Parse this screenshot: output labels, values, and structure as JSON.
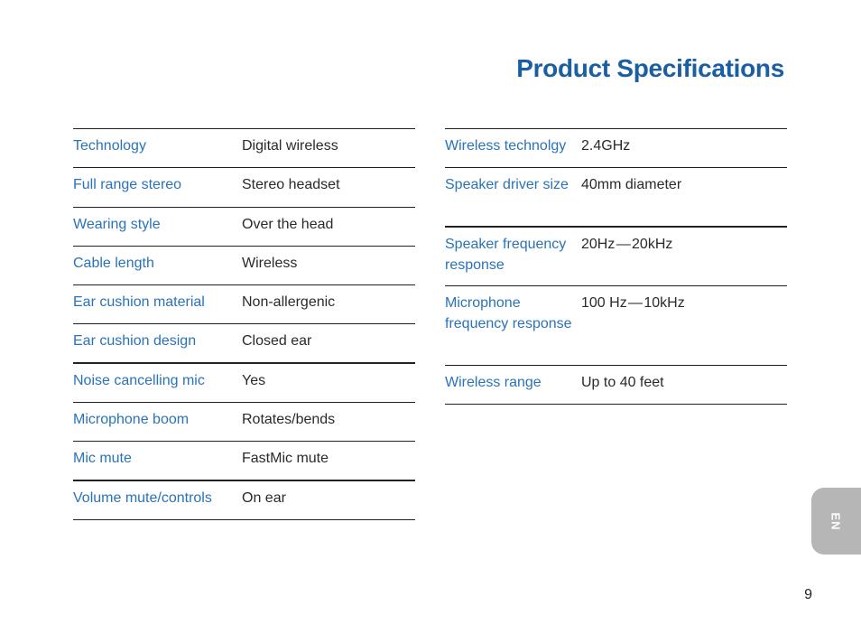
{
  "page": {
    "title": "Product Specifications",
    "language_tab": "EN",
    "page_number": "9"
  },
  "specs_left": [
    {
      "label": "Technology",
      "value": "Digital wireless"
    },
    {
      "label": "Full range stereo",
      "value": "Stereo headset"
    },
    {
      "label": "Wearing style",
      "value": "Over the head"
    },
    {
      "label": "Cable length",
      "value": "Wireless"
    },
    {
      "label": "Ear cushion material",
      "value": "Non-allergenic"
    },
    {
      "label": "Ear cushion design",
      "value": "Closed ear"
    },
    {
      "label": "Noise cancelling mic",
      "value": "Yes"
    },
    {
      "label": "Microphone boom",
      "value": "Rotates/bends"
    },
    {
      "label": "Mic mute",
      "value": "FastMic mute"
    },
    {
      "label": "Volume mute/controls",
      "value": "On ear"
    }
  ],
  "specs_right": [
    {
      "label": "Wireless technolgy",
      "value": "2.4GHz"
    },
    {
      "label": "Speaker driver size",
      "value": "40mm diameter"
    },
    {
      "label": "Speaker frequency response",
      "value": "20Hz — 20kHz"
    },
    {
      "label": "Microphone frequency response",
      "value": "100 Hz — 10kHz"
    },
    {
      "label": "Wireless range",
      "value": "Up to 40 feet"
    }
  ],
  "colors": {
    "title": "#1a5fa2",
    "label": "#2a73b8",
    "value": "#2a2a2a",
    "tab_background": "#b6b6b6"
  }
}
